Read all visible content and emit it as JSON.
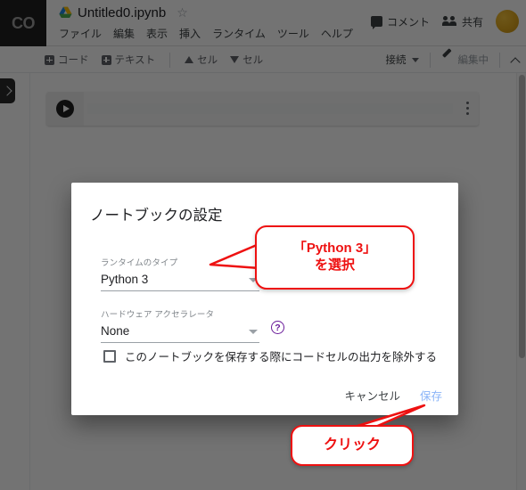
{
  "header": {
    "logo_label": "CO",
    "drive_icon": "google-drive-icon",
    "notebook_title": "Untitled0.ipynb",
    "star_glyph": "☆",
    "menu_items": [
      {
        "label": "ファイル"
      },
      {
        "label": "編集"
      },
      {
        "label": "表示"
      },
      {
        "label": "挿入"
      },
      {
        "label": "ランタイム"
      },
      {
        "label": "ツール"
      },
      {
        "label": "ヘルプ"
      }
    ],
    "comment_label": "コメント",
    "share_label": "共有",
    "avatar_name": "user-avatar"
  },
  "toolbar": {
    "add_code_label": "コード",
    "add_text_label": "テキスト",
    "move_cell_up_label": "セル",
    "move_cell_down_label": "セル",
    "connect_label": "接続",
    "editing_label": "編集中",
    "collapse_icon": "chevron-up-icon"
  },
  "notebook": {
    "sidebar_toggle_icon": "chevron-right-icon",
    "cell": {
      "run_icon": "play-icon",
      "code_value": "",
      "overflow_icon": "more-vertical-icon"
    }
  },
  "dialog": {
    "title": "ノートブックの設定",
    "runtime": {
      "label": "ランタイムのタイプ",
      "value": "Python 3",
      "caret_icon": "caret-down-icon"
    },
    "accelerator": {
      "label": "ハードウェア アクセラレータ",
      "value": "None",
      "caret_icon": "caret-down-icon",
      "help_glyph": "?"
    },
    "omit_output": {
      "label": "このノートブックを保存する際にコードセルの出力を除外する",
      "checked": false
    },
    "cancel_label": "キャンセル",
    "save_label": "保存"
  },
  "annotations": {
    "python_callout": {
      "line1": "「Python 3」",
      "line2": "を選択"
    },
    "click_callout": {
      "line1": "クリック"
    }
  },
  "colors": {
    "annotation_red": "#ee1111",
    "save_blue": "#8ab4f8",
    "help_purple": "#6a1b9a",
    "scrim": "rgba(0,0,0,0.55)"
  }
}
